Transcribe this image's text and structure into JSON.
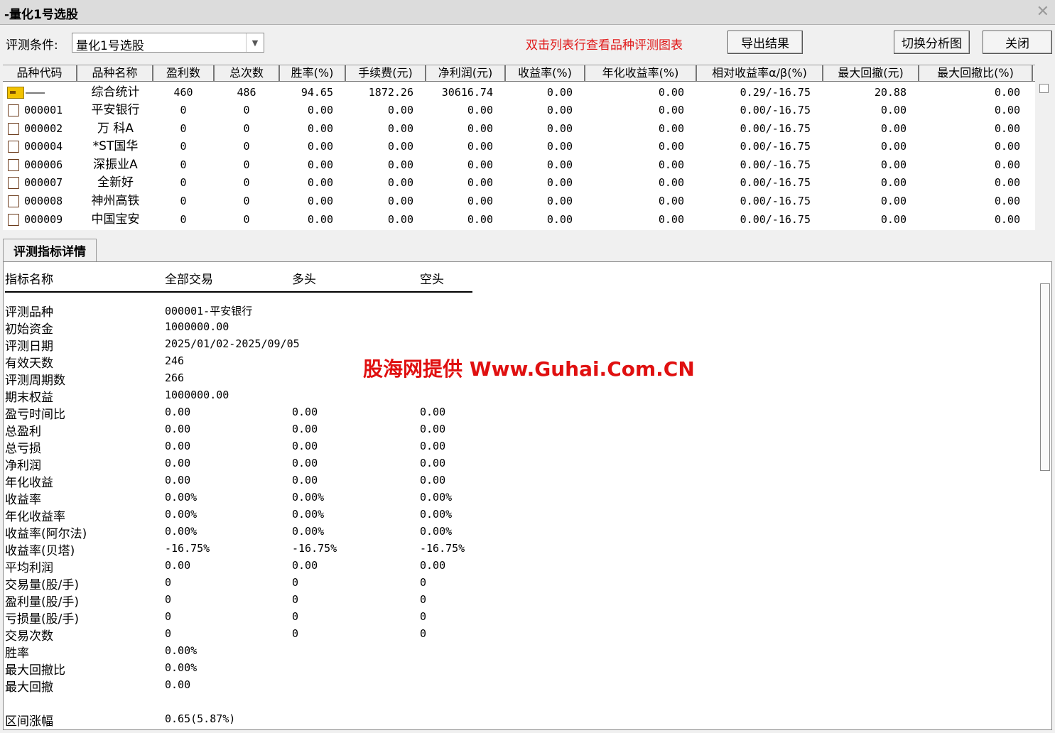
{
  "window": {
    "title": "-量化1号选股"
  },
  "toolbar": {
    "condition_label": "评测条件:",
    "condition_value": "量化1号选股",
    "hint": "双击列表行查看品种评测图表",
    "export_label": "导出结果",
    "switch_label": "切换分析图",
    "close_label": "关闭"
  },
  "table": {
    "headers": [
      "品种代码",
      "品种名称",
      "盈利数",
      "总次数",
      "胜率(%)",
      "手续费(元)",
      "净利润(元)",
      "收益率(%)",
      "年化收益率(%)",
      "相对收益率α/β(%)",
      "最大回撤(元)",
      "最大回撤比(%)"
    ],
    "summary_row": [
      "———",
      "综合统计",
      "460",
      "486",
      "94.65",
      "1872.26",
      "30616.74",
      "0.00",
      "0.00",
      "0.29/-16.75",
      "20.88",
      "0.00"
    ],
    "rows": [
      [
        "000001",
        "平安银行",
        "0",
        "0",
        "0.00",
        "0.00",
        "0.00",
        "0.00",
        "0.00",
        "0.00/-16.75",
        "0.00",
        "0.00"
      ],
      [
        "000002",
        "万 科A",
        "0",
        "0",
        "0.00",
        "0.00",
        "0.00",
        "0.00",
        "0.00",
        "0.00/-16.75",
        "0.00",
        "0.00"
      ],
      [
        "000004",
        "*ST国华",
        "0",
        "0",
        "0.00",
        "0.00",
        "0.00",
        "0.00",
        "0.00",
        "0.00/-16.75",
        "0.00",
        "0.00"
      ],
      [
        "000006",
        "深振业A",
        "0",
        "0",
        "0.00",
        "0.00",
        "0.00",
        "0.00",
        "0.00",
        "0.00/-16.75",
        "0.00",
        "0.00"
      ],
      [
        "000007",
        "全新好",
        "0",
        "0",
        "0.00",
        "0.00",
        "0.00",
        "0.00",
        "0.00",
        "0.00/-16.75",
        "0.00",
        "0.00"
      ],
      [
        "000008",
        "神州高铁",
        "0",
        "0",
        "0.00",
        "0.00",
        "0.00",
        "0.00",
        "0.00",
        "0.00/-16.75",
        "0.00",
        "0.00"
      ],
      [
        "000009",
        "中国宝安",
        "0",
        "0",
        "0.00",
        "0.00",
        "0.00",
        "0.00",
        "0.00",
        "0.00/-16.75",
        "0.00",
        "0.00"
      ]
    ]
  },
  "tab": {
    "label": "评测指标详情"
  },
  "details": {
    "headers": [
      "指标名称",
      "全部交易",
      "多头",
      "空头"
    ],
    "rows": [
      [
        "评测品种",
        "000001-平安银行",
        "",
        ""
      ],
      [
        "初始资金",
        "1000000.00",
        "",
        ""
      ],
      [
        "评测日期",
        "2025/01/02-2025/09/05",
        "",
        ""
      ],
      [
        "有效天数",
        "246",
        "",
        ""
      ],
      [
        "评测周期数",
        "266",
        "",
        ""
      ],
      [
        "期末权益",
        "1000000.00",
        "",
        ""
      ],
      [
        "盈亏时间比",
        "0.00",
        "0.00",
        "0.00"
      ],
      [
        "总盈利",
        "0.00",
        "0.00",
        "0.00"
      ],
      [
        "总亏损",
        "0.00",
        "0.00",
        "0.00"
      ],
      [
        "净利润",
        "0.00",
        "0.00",
        "0.00"
      ],
      [
        "年化收益",
        "0.00",
        "0.00",
        "0.00"
      ],
      [
        "收益率",
        "0.00%",
        "0.00%",
        "0.00%"
      ],
      [
        "年化收益率",
        "0.00%",
        "0.00%",
        "0.00%"
      ],
      [
        "收益率(阿尔法)",
        "0.00%",
        "0.00%",
        "0.00%"
      ],
      [
        "收益率(贝塔)",
        "-16.75%",
        "-16.75%",
        "-16.75%"
      ],
      [
        "平均利润",
        "0.00",
        "0.00",
        "0.00"
      ],
      [
        "交易量(股/手)",
        "0",
        "0",
        "0"
      ],
      [
        "盈利量(股/手)",
        "0",
        "0",
        "0"
      ],
      [
        "亏损量(股/手)",
        "0",
        "0",
        "0"
      ],
      [
        "交易次数",
        "0",
        "0",
        "0"
      ],
      [
        "胜率",
        "0.00%",
        "",
        ""
      ],
      [
        "最大回撤比",
        "0.00%",
        "",
        ""
      ],
      [
        "最大回撤",
        "0.00",
        "",
        ""
      ],
      [
        "",
        "",
        "",
        ""
      ],
      [
        "区间涨幅",
        "0.65(5.87%)",
        "",
        ""
      ]
    ]
  },
  "watermark": "股海网提供 Www.Guhai.Com.CN",
  "colors": {
    "hint": "#e01818",
    "watermark": "#e01010"
  },
  "icons": {
    "summary": "summary-folder-icon",
    "stock": "stock-doc-icon",
    "close": "close-icon"
  }
}
